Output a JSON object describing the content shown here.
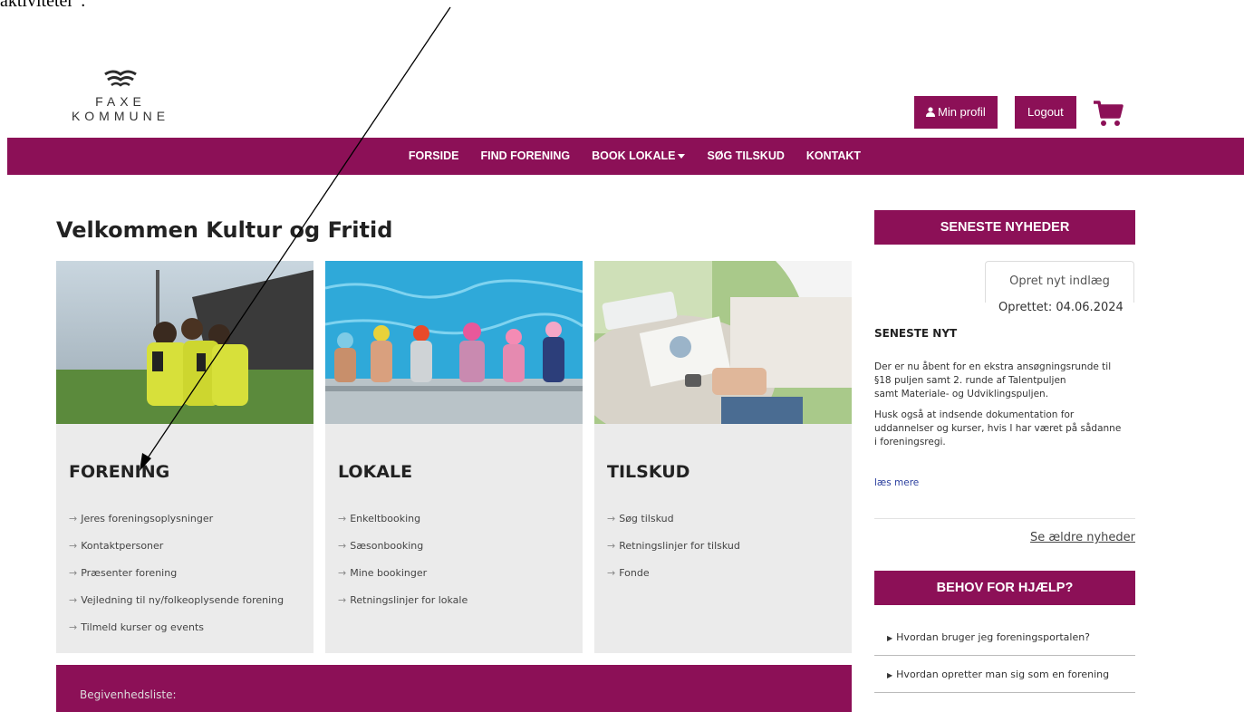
{
  "overlay": {
    "note_text": "aktiviteter\"."
  },
  "logo": {
    "line1": "FAXE",
    "line2": "KOMMUNE"
  },
  "header": {
    "min_profil": "Min profil",
    "logout": "Logout",
    "cart_icon": "shopping-cart-icon"
  },
  "nav": {
    "items": [
      "FORSIDE",
      "FIND FORENING",
      "BOOK LOKALE",
      "SØG TILSKUD",
      "KONTAKT"
    ]
  },
  "main": {
    "title": "Velkommen Kultur og Fritid"
  },
  "cards": [
    {
      "title": "FORENING",
      "links": [
        "Jeres foreningsoplysninger",
        "Kontaktpersoner",
        "Præsenter forening",
        "Vejledning til ny/folkeoplysende forening",
        "Tilmeld kurser og events"
      ]
    },
    {
      "title": "LOKALE",
      "links": [
        "Enkeltbooking",
        "Sæsonbooking",
        "Mine bookinger",
        "Retningslinjer for lokale"
      ]
    },
    {
      "title": "TILSKUD",
      "links": [
        "Søg tilskud",
        "Retningslinjer for tilskud",
        "Fonde"
      ]
    }
  ],
  "bottom": {
    "text": "Begivenhedsliste:"
  },
  "sidebar": {
    "news_header": "SENESTE NYHEDER",
    "new_post": "Opret nyt indlæg",
    "created": "Oprettet: 04.06.2024",
    "news_title": "SENESTE NYT",
    "news_p1_l1": "Der er nu åbent for en ekstra ansøgningsrunde til",
    "news_p1_l2": "§18 puljen samt 2. runde af Talentpuljen",
    "news_p1_l3": "samt Materiale- og Udviklingspuljen.",
    "news_p2_l1": "Husk også at indsende dokumentation for",
    "news_p2_l2": "uddannelser og kurser, hvis I har været på sådanne",
    "news_p2_l3": "i foreningsregi.",
    "read_more": "læs mere",
    "older_news": "Se ældre nyheder",
    "help_header": "BEHOV FOR HJÆLP?",
    "faq": [
      "Hvordan bruger jeg foreningsportalen?",
      "Hvordan opretter man sig som en forening"
    ]
  },
  "colors": {
    "brand": "#8c1057",
    "card_bg": "#ebebeb",
    "link": "#2b3f9e"
  }
}
